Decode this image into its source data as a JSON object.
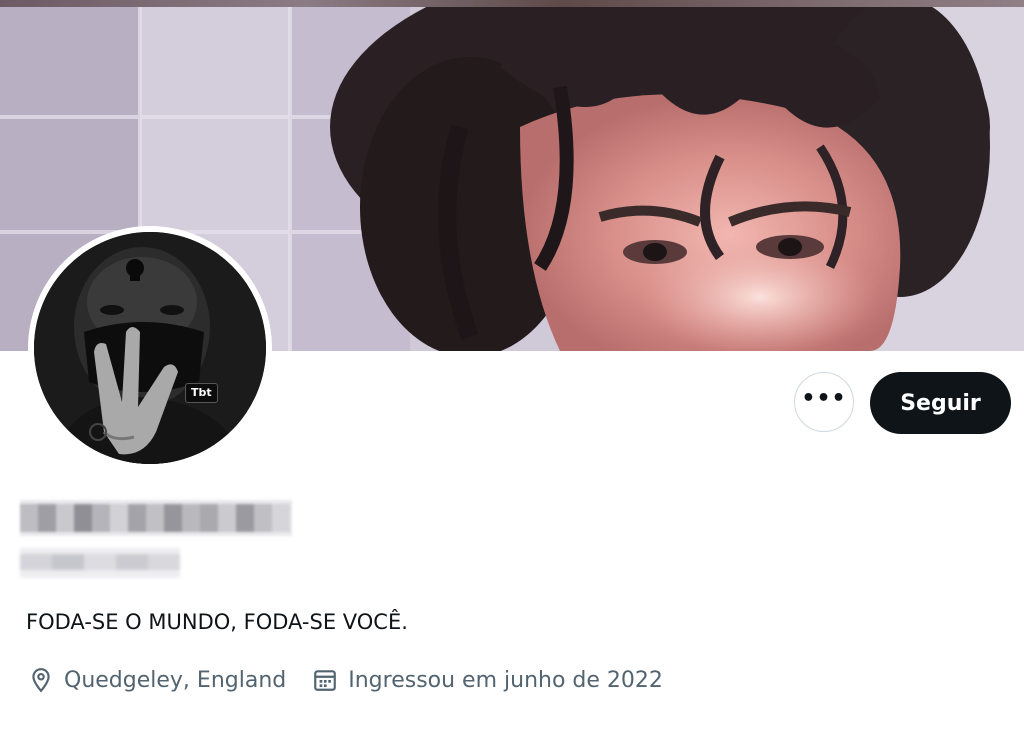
{
  "profile": {
    "tbt_badge": "Tbt",
    "more_icon": "more-horizontal-icon",
    "follow_label": "Seguir",
    "bio": "FODA-SE O MUNDO, FODA-SE VOCÊ.",
    "location": "Quedgeley, England",
    "joined": "Ingressou em junho de 2022",
    "location_icon": "location-pin-icon",
    "joined_icon": "calendar-icon"
  },
  "colors": {
    "follow_bg": "#0f1419",
    "text_primary": "#0f1419",
    "text_secondary": "#536471",
    "border": "#cfd9de"
  }
}
